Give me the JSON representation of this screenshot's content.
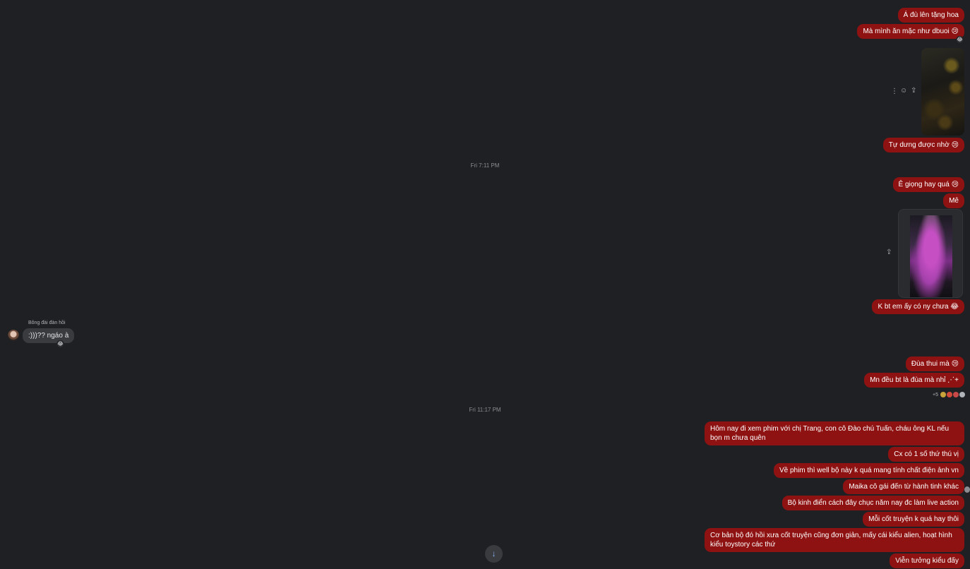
{
  "messages_top": [
    {
      "text": "Á đù lên tặng hoa"
    },
    {
      "text": "Mà mình ăn mặc như dbuoi 😢",
      "reaction": "😂"
    },
    {
      "text": "Tự dưng được nhờ 😢"
    }
  ],
  "timestamp_1": "Fri 7:11 PM",
  "messages_mid": [
    {
      "text": "Ê giọng hay quá 😢"
    },
    {
      "text": "Mê"
    },
    {
      "text": "K bt em ấy có ny chưa 😂"
    }
  ],
  "incoming": {
    "sender": "Bông đài đàn hồi",
    "text": ":)))?? ngáo à",
    "reaction": "😂"
  },
  "messages_after": [
    {
      "text": "Đùa thui mà 😢"
    },
    {
      "text": "Mn đều bt là đùa mà nhỉ ⋰+"
    }
  ],
  "reactions_summary": {
    "count": "+5"
  },
  "timestamp_2": "Fri 11:17 PM",
  "messages_bottom": [
    {
      "text": "Hôm nay đi xem phim với chị Trang, con cô Đào chú Tuấn, cháu ông KL nếu bọn m chưa quên"
    },
    {
      "text": "Cx có 1 số thứ thú vị"
    },
    {
      "text": "Về phim thì well bộ này k quá mang tính chất điện ảnh vn"
    },
    {
      "text": "Maika cô gái đến từ hành tinh khác"
    },
    {
      "text": "Bộ kinh điển cách đây chục năm nay đc làm live action"
    },
    {
      "text": "Mỗi cốt truyện k quá hay thôi"
    },
    {
      "text": "Cơ bản bộ đó hồi xưa cốt truyện cũng đơn giản, mấy cái kiểu alien, hoạt hình kiểu toystory các thứ"
    },
    {
      "text": "Viễn tưởng kiểu đấy"
    }
  ],
  "icons": {
    "more": "⋮",
    "react": "☺",
    "share": "⇪",
    "scroll_down": "↓"
  },
  "colors": {
    "background": "#1f2023",
    "outgoing_bubble": "#8e1212",
    "incoming_bubble": "#3a3b3e"
  }
}
